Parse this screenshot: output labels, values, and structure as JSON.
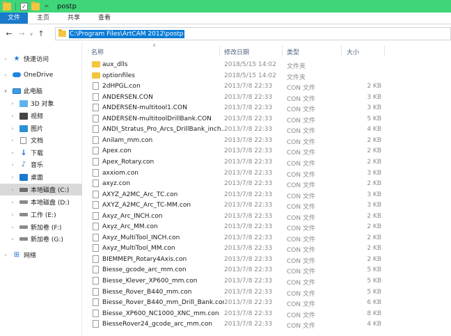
{
  "window": {
    "title": "postp",
    "quick_access_drop": "="
  },
  "ribbon": {
    "tabs": [
      "文件",
      "主页",
      "共享",
      "查看"
    ]
  },
  "nav": {
    "back": "←",
    "forward": "→",
    "history": "∨",
    "up": "↑",
    "address": "C:\\Program Files\\ArtCAM 2012\\postp"
  },
  "sidebar": {
    "items": [
      {
        "label": "快速访问",
        "icon": "star-icon"
      },
      {
        "label": "OneDrive",
        "icon": "cloud-icon"
      },
      {
        "label": "此电脑",
        "icon": "computer-icon"
      },
      {
        "label": "3D 对象",
        "icon": "cube-icon"
      },
      {
        "label": "视频",
        "icon": "video-icon"
      },
      {
        "label": "图片",
        "icon": "picture-icon"
      },
      {
        "label": "文档",
        "icon": "document-icon"
      },
      {
        "label": "下载",
        "icon": "download-icon"
      },
      {
        "label": "音乐",
        "icon": "music-icon"
      },
      {
        "label": "桌面",
        "icon": "desktop-icon"
      },
      {
        "label": "本地磁盘 (C:)",
        "icon": "drive-c-icon"
      },
      {
        "label": "本地磁盘 (D:)",
        "icon": "drive-icon"
      },
      {
        "label": "工作 (E:)",
        "icon": "drive-icon"
      },
      {
        "label": "新加卷 (F:)",
        "icon": "drive-icon"
      },
      {
        "label": "新加卷 (G:)",
        "icon": "drive-icon"
      },
      {
        "label": "网络",
        "icon": "network-icon"
      }
    ]
  },
  "columns": {
    "name": "名称",
    "modified": "修改日期",
    "type": "类型",
    "size": "大小"
  },
  "files": [
    {
      "name": "aux_dlls",
      "date": "2018/5/15 14:02",
      "type": "文件夹",
      "size": "",
      "folder": true
    },
    {
      "name": "optionfiles",
      "date": "2018/5/15 14:02",
      "type": "文件夹",
      "size": "",
      "folder": true
    },
    {
      "name": "2dHPGL.con",
      "date": "2013/7/8 22:33",
      "type": "CON 文件",
      "size": "2 KB"
    },
    {
      "name": "ANDERSEN.CON",
      "date": "2013/7/8 22:33",
      "type": "CON 文件",
      "size": "3 KB"
    },
    {
      "name": "ANDERSEN-multitool1.CON",
      "date": "2013/7/8 22:33",
      "type": "CON 文件",
      "size": "3 KB"
    },
    {
      "name": "ANDERSEN-multitoolDrillBank.CON",
      "date": "2013/7/8 22:33",
      "type": "CON 文件",
      "size": "5 KB"
    },
    {
      "name": "ANDI_Stratus_Pro_Arcs_DrillBank_inch...",
      "date": "2013/7/8 22:33",
      "type": "CON 文件",
      "size": "4 KB"
    },
    {
      "name": "Anilam_mm.con",
      "date": "2013/7/8 22:33",
      "type": "CON 文件",
      "size": "2 KB"
    },
    {
      "name": "Apex.con",
      "date": "2013/7/8 22:33",
      "type": "CON 文件",
      "size": "2 KB"
    },
    {
      "name": "Apex_Rotary.con",
      "date": "2013/7/8 22:33",
      "type": "CON 文件",
      "size": "2 KB"
    },
    {
      "name": "axxiom.con",
      "date": "2013/7/8 22:33",
      "type": "CON 文件",
      "size": "3 KB"
    },
    {
      "name": "axyz.con",
      "date": "2013/7/8 22:33",
      "type": "CON 文件",
      "size": "2 KB"
    },
    {
      "name": "AXYZ_A2MC_Arc_TC.con",
      "date": "2013/7/8 22:33",
      "type": "CON 文件",
      "size": "3 KB"
    },
    {
      "name": "AXYZ_A2MC_Arc_TC-MM.con",
      "date": "2013/7/8 22:33",
      "type": "CON 文件",
      "size": "3 KB"
    },
    {
      "name": "Axyz_Arc_INCH.con",
      "date": "2013/7/8 22:33",
      "type": "CON 文件",
      "size": "2 KB"
    },
    {
      "name": "Axyz_Arc_MM.con",
      "date": "2013/7/8 22:33",
      "type": "CON 文件",
      "size": "2 KB"
    },
    {
      "name": "Axyz_MultiTool_INCH.con",
      "date": "2013/7/8 22:33",
      "type": "CON 文件",
      "size": "2 KB"
    },
    {
      "name": "Axyz_MultiTool_MM.con",
      "date": "2013/7/8 22:33",
      "type": "CON 文件",
      "size": "2 KB"
    },
    {
      "name": "BIEMMEPI_Rotary4Axis.con",
      "date": "2013/7/8 22:33",
      "type": "CON 文件",
      "size": "2 KB"
    },
    {
      "name": "Biesse_gcode_arc_mm.con",
      "date": "2013/7/8 22:33",
      "type": "CON 文件",
      "size": "5 KB"
    },
    {
      "name": "Biesse_Klever_XP600_mm.con",
      "date": "2013/7/8 22:33",
      "type": "CON 文件",
      "size": "5 KB"
    },
    {
      "name": "Biesse_Rover_B440_mm.con",
      "date": "2013/7/8 22:33",
      "type": "CON 文件",
      "size": "5 KB"
    },
    {
      "name": "Biesse_Rover_B440_mm_Drill_Bank.con",
      "date": "2013/7/8 22:33",
      "type": "CON 文件",
      "size": "6 KB"
    },
    {
      "name": "Biesse_XP600_NC1000_XNC_mm.con",
      "date": "2013/7/8 22:33",
      "type": "CON 文件",
      "size": "8 KB"
    },
    {
      "name": "BiesseRover24_gcode_arc_mm.con",
      "date": "2013/7/8 22:33",
      "type": "CON 文件",
      "size": "4 KB"
    }
  ]
}
